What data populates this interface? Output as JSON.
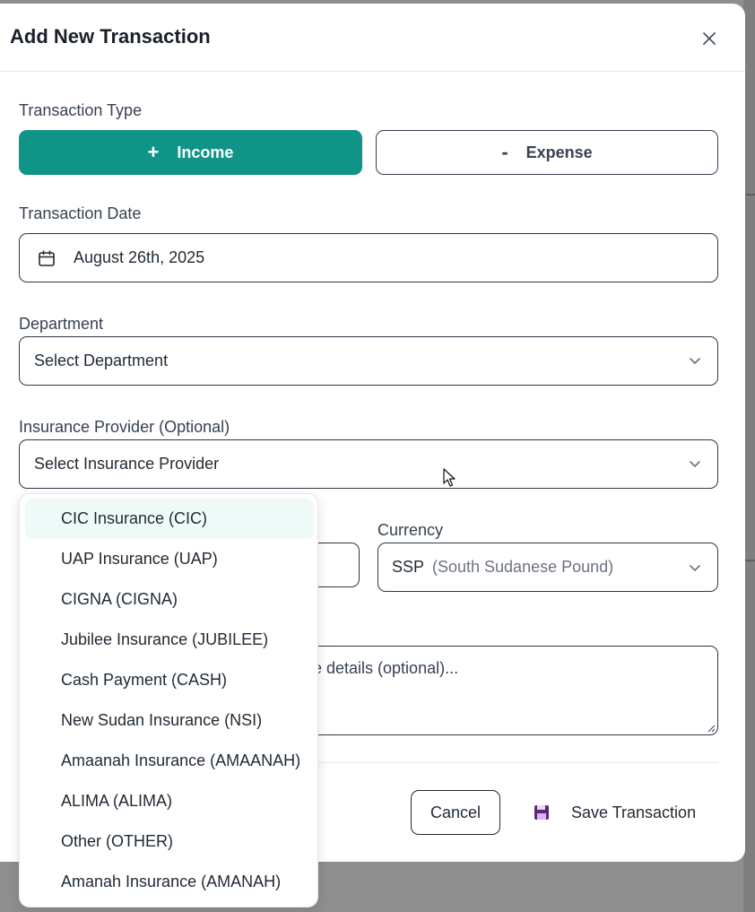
{
  "dialog": {
    "title": "Add New Transaction",
    "close_icon": "close-icon"
  },
  "transaction_type": {
    "label": "Transaction Type",
    "income": {
      "symbol": "+",
      "label": "Income",
      "selected": true
    },
    "expense": {
      "symbol": "-",
      "label": "Expense",
      "selected": false
    }
  },
  "transaction_date": {
    "label": "Transaction Date",
    "value": "August 26th, 2025",
    "icon": "calendar-icon"
  },
  "department": {
    "label": "Department",
    "placeholder": "Select Department"
  },
  "insurance_provider": {
    "label": "Insurance Provider (Optional)",
    "placeholder": "Select Insurance Provider",
    "options": [
      "CIC Insurance (CIC)",
      "UAP Insurance (UAP)",
      "CIGNA (CIGNA)",
      "Jubilee Insurance (JUBILEE)",
      "Cash Payment (CASH)",
      "New Sudan Insurance (NSI)",
      "Amaanah Insurance (AMAANAH)",
      "ALIMA (ALIMA)",
      "Other (OTHER)",
      "Amanah Insurance (AMANAH)"
    ],
    "highlighted_index": 0
  },
  "currency": {
    "label": "Currency",
    "code": "SSP",
    "name": "(South Sudanese Pound)"
  },
  "description": {
    "visible_placeholder_fragment": "se details (optional)..."
  },
  "actions": {
    "cancel_label": "Cancel",
    "save_label": "Save Transaction",
    "save_icon": "floppy-disk-icon"
  },
  "colors": {
    "accent": "#109488",
    "highlight": "#effaf8",
    "save_icon": "#5b2a6e"
  }
}
